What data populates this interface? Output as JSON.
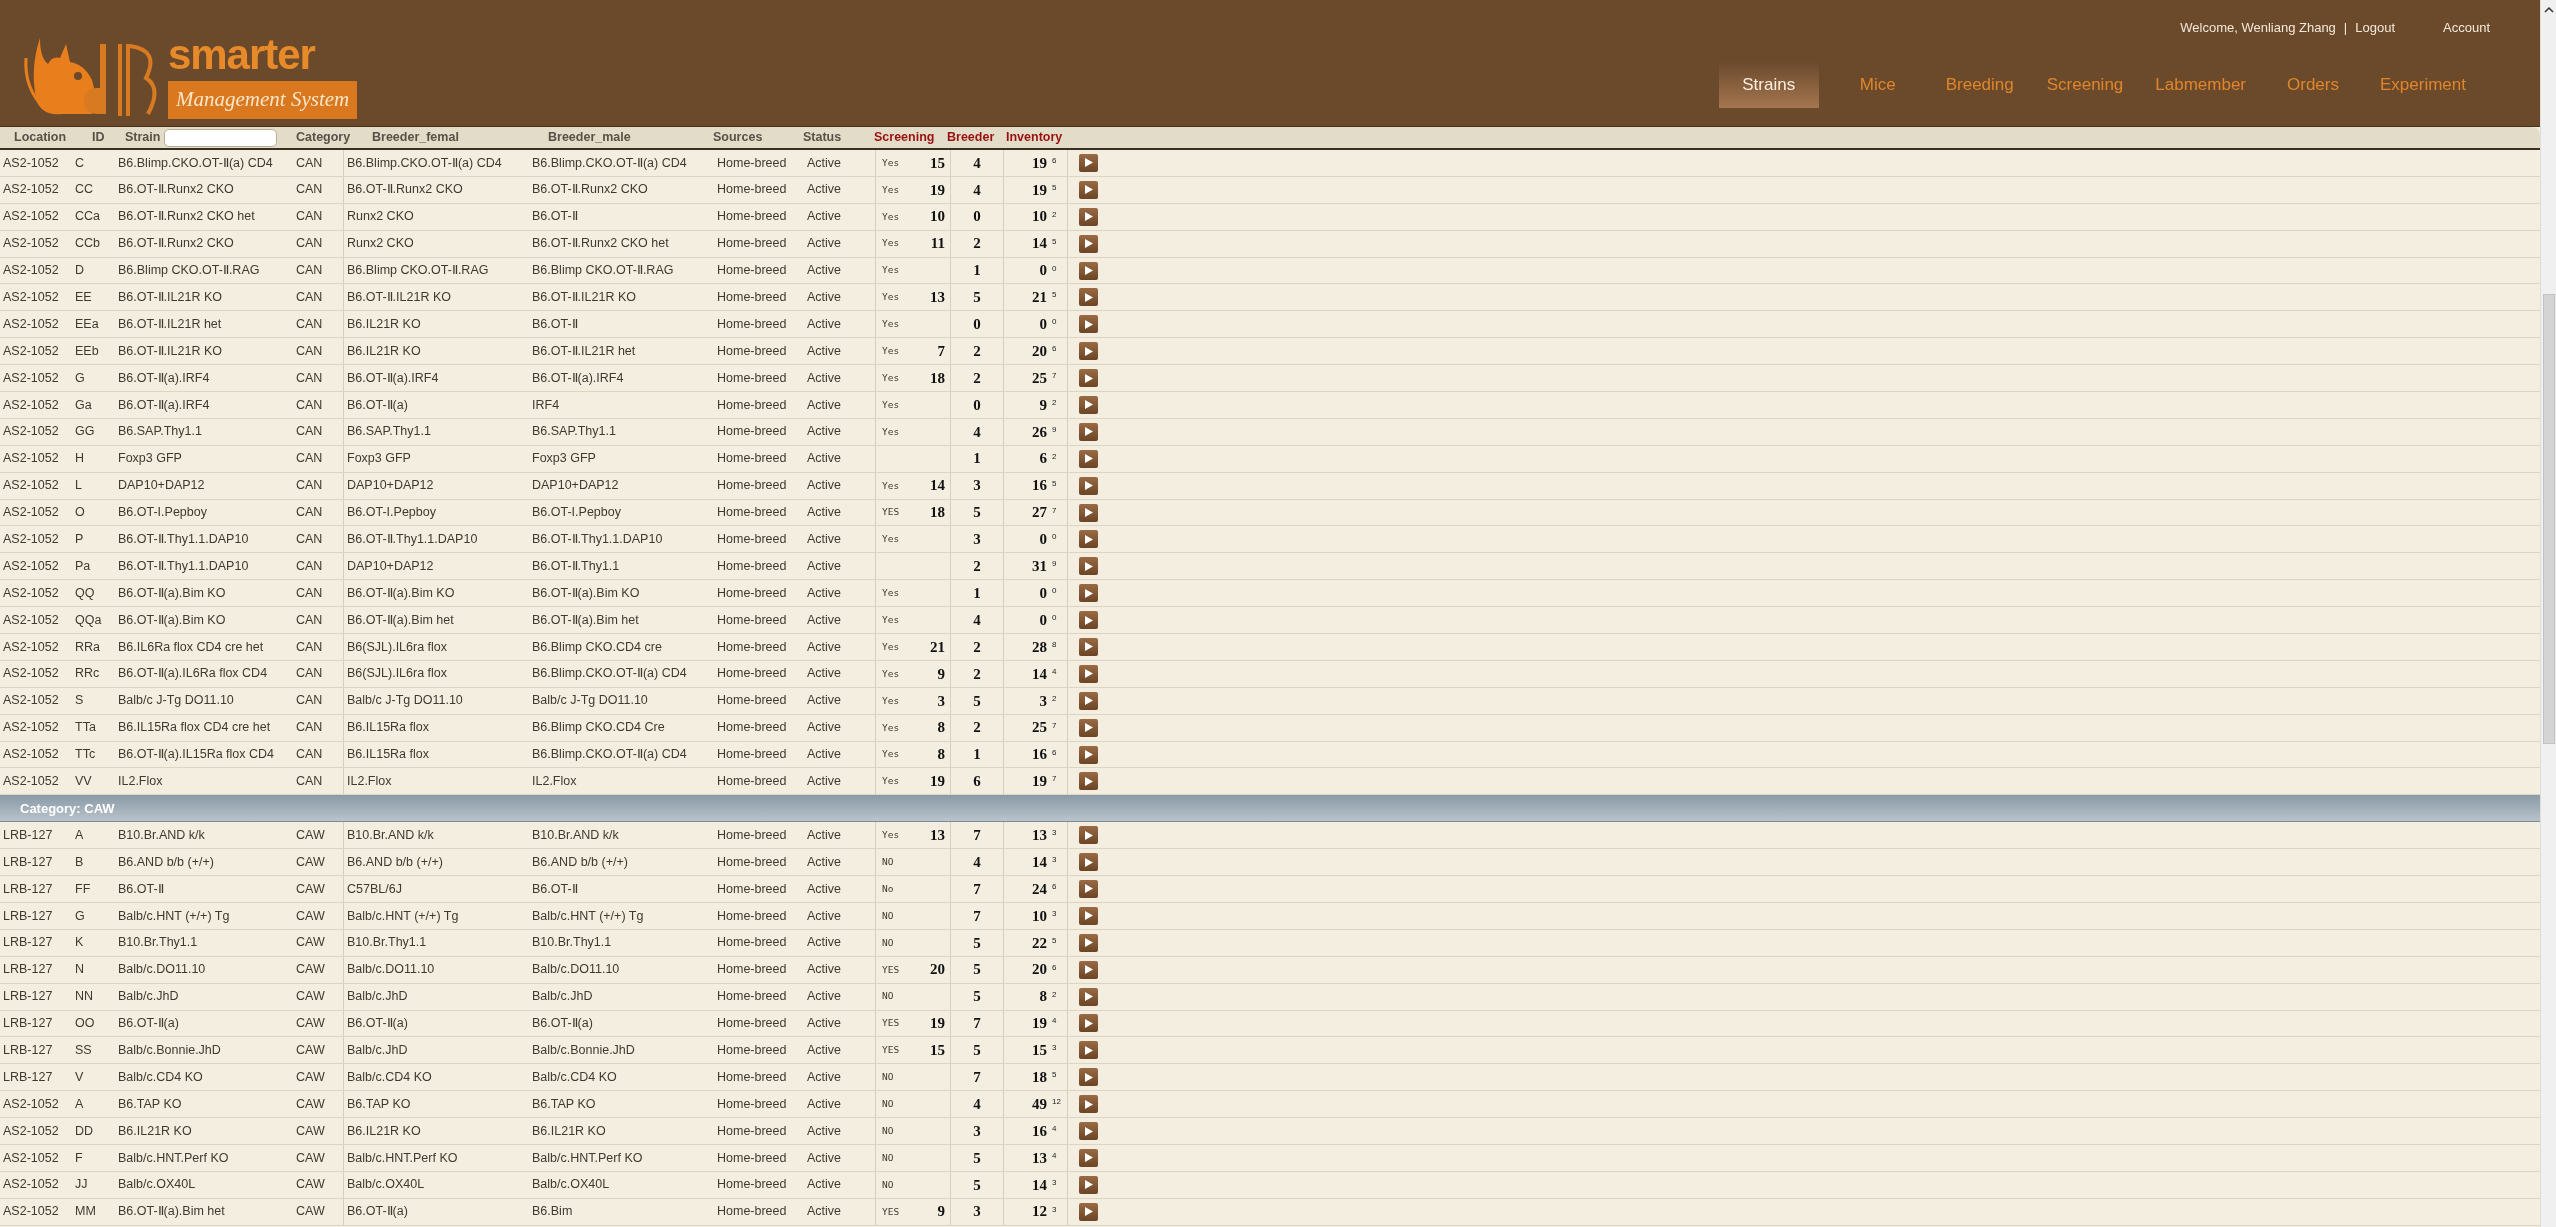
{
  "logo": {
    "word": "smarter",
    "tagline": "Management System"
  },
  "user_bar": {
    "welcome": "Welcome, Wenliang Zhang",
    "separator": "|",
    "logout": "Logout",
    "account": "Account"
  },
  "tabs": [
    {
      "label": "Strains",
      "selected": true
    },
    {
      "label": "Mice",
      "selected": false
    },
    {
      "label": "Breeding",
      "selected": false
    },
    {
      "label": "Screening",
      "selected": false
    },
    {
      "label": "Labmember",
      "selected": false
    },
    {
      "label": "Orders",
      "selected": false
    },
    {
      "label": "Experiment",
      "selected": false
    }
  ],
  "table": {
    "columns": [
      {
        "label": "Location",
        "kind": "plain"
      },
      {
        "label": "ID",
        "kind": "plain"
      },
      {
        "label": "Strain",
        "kind": "filter"
      },
      {
        "label": "Category",
        "kind": "plain"
      },
      {
        "label": "Breeder_femal",
        "kind": "plain"
      },
      {
        "label": "Breeder_male",
        "kind": "plain"
      },
      {
        "label": "Sources",
        "kind": "plain"
      },
      {
        "label": "Status",
        "kind": "plain"
      },
      {
        "label": "Screening",
        "kind": "count"
      },
      {
        "label": "Breeder",
        "kind": "count"
      },
      {
        "label": "Inventory",
        "kind": "count"
      }
    ],
    "groups": [
      {
        "rows": [
          {
            "location": "AS2-1052",
            "id": "C",
            "strain": "B6.Blimp.CKO.OT-Ⅱ(a) CD4",
            "category": "CAN",
            "breeder_female": "B6.Blimp.CKO.OT-Ⅱ(a) CD4",
            "breeder_male": "B6.Blimp.CKO.OT-Ⅱ(a) CD4",
            "source": "Home-breed",
            "status": "Active",
            "screening": "Yes",
            "screening_count": "15",
            "breeder": "4",
            "inventory": "19",
            "inventory_note": "6"
          },
          {
            "location": "AS2-1052",
            "id": "CC",
            "strain": "B6.OT-Ⅱ.Runx2 CKO",
            "category": "CAN",
            "breeder_female": "B6.OT-Ⅱ.Runx2 CKO",
            "breeder_male": "B6.OT-Ⅱ.Runx2 CKO",
            "source": "Home-breed",
            "status": "Active",
            "screening": "Yes",
            "screening_count": "19",
            "breeder": "4",
            "inventory": "19",
            "inventory_note": "5"
          },
          {
            "location": "AS2-1052",
            "id": "CCa",
            "strain": "B6.OT-Ⅱ.Runx2 CKO het",
            "category": "CAN",
            "breeder_female": "Runx2 CKO",
            "breeder_male": "B6.OT-Ⅱ",
            "source": "Home-breed",
            "status": "Active",
            "screening": "Yes",
            "screening_count": "10",
            "breeder": "0",
            "inventory": "10",
            "inventory_note": "2"
          },
          {
            "location": "AS2-1052",
            "id": "CCb",
            "strain": "B6.OT-Ⅱ.Runx2 CKO",
            "category": "CAN",
            "breeder_female": "Runx2 CKO",
            "breeder_male": "B6.OT-Ⅱ.Runx2 CKO het",
            "source": "Home-breed",
            "status": "Active",
            "screening": "Yes",
            "screening_count": "11",
            "breeder": "2",
            "inventory": "14",
            "inventory_note": "5"
          },
          {
            "location": "AS2-1052",
            "id": "D",
            "strain": "B6.Blimp CKO.OT-Ⅱ.RAG",
            "category": "CAN",
            "breeder_female": "B6.Blimp CKO.OT-Ⅱ.RAG",
            "breeder_male": "B6.Blimp CKO.OT-Ⅱ.RAG",
            "source": "Home-breed",
            "status": "Active",
            "screening": "Yes",
            "breeder": "1",
            "inventory": "0",
            "inventory_note": "0"
          },
          {
            "location": "AS2-1052",
            "id": "EE",
            "strain": "B6.OT-Ⅱ.IL21R KO",
            "category": "CAN",
            "breeder_female": "B6.OT-Ⅱ.IL21R KO",
            "breeder_male": "B6.OT-Ⅱ.IL21R KO",
            "source": "Home-breed",
            "status": "Active",
            "screening": "Yes",
            "screening_count": "13",
            "breeder": "5",
            "inventory": "21",
            "inventory_note": "5"
          },
          {
            "location": "AS2-1052",
            "id": "EEa",
            "strain": "B6.OT-Ⅱ.IL21R het",
            "category": "CAN",
            "breeder_female": "B6.IL21R KO",
            "breeder_male": "B6.OT-Ⅱ",
            "source": "Home-breed",
            "status": "Active",
            "screening": "Yes",
            "breeder": "0",
            "inventory": "0",
            "inventory_note": "0"
          },
          {
            "location": "AS2-1052",
            "id": "EEb",
            "strain": "B6.OT-Ⅱ.IL21R KO",
            "category": "CAN",
            "breeder_female": "B6.IL21R KO",
            "breeder_male": "B6.OT-Ⅱ.IL21R het",
            "source": "Home-breed",
            "status": "Active",
            "screening": "Yes",
            "screening_count": "7",
            "breeder": "2",
            "inventory": "20",
            "inventory_note": "6"
          },
          {
            "location": "AS2-1052",
            "id": "G",
            "strain": "B6.OT-Ⅱ(a).IRF4",
            "category": "CAN",
            "breeder_female": "B6.OT-Ⅱ(a).IRF4",
            "breeder_male": "B6.OT-Ⅱ(a).IRF4",
            "source": "Home-breed",
            "status": "Active",
            "screening": "Yes",
            "screening_count": "18",
            "breeder": "2",
            "inventory": "25",
            "inventory_note": "7"
          },
          {
            "location": "AS2-1052",
            "id": "Ga",
            "strain": "B6.OT-Ⅱ(a).IRF4",
            "category": "CAN",
            "breeder_female": "B6.OT-Ⅱ(a)",
            "breeder_male": "IRF4",
            "source": "Home-breed",
            "status": "Active",
            "screening": "Yes",
            "breeder": "0",
            "inventory": "9",
            "inventory_note": "2"
          },
          {
            "location": "AS2-1052",
            "id": "GG",
            "strain": "B6.SAP.Thy1.1",
            "category": "CAN",
            "breeder_female": "B6.SAP.Thy1.1",
            "breeder_male": "B6.SAP.Thy1.1",
            "source": "Home-breed",
            "status": "Active",
            "screening": "Yes",
            "breeder": "4",
            "inventory": "26",
            "inventory_note": "9"
          },
          {
            "location": "AS2-1052",
            "id": "H",
            "strain": "Foxp3 GFP",
            "category": "CAN",
            "breeder_female": "Foxp3 GFP",
            "breeder_male": "Foxp3 GFP",
            "source": "Home-breed",
            "status": "Active",
            "breeder": "1",
            "inventory": "6",
            "inventory_note": "2"
          },
          {
            "location": "AS2-1052",
            "id": "L",
            "strain": "DAP10+DAP12",
            "category": "CAN",
            "breeder_female": "DAP10+DAP12",
            "breeder_male": "DAP10+DAP12",
            "source": "Home-breed",
            "status": "Active",
            "screening": "Yes",
            "screening_count": "14",
            "breeder": "3",
            "inventory": "16",
            "inventory_note": "5"
          },
          {
            "location": "AS2-1052",
            "id": "O",
            "strain": "B6.OT-I.Pepboy",
            "category": "CAN",
            "breeder_female": "B6.OT-I.Pepboy",
            "breeder_male": "B6.OT-I.Pepboy",
            "source": "Home-breed",
            "status": "Active",
            "screening": "YES",
            "screening_count": "18",
            "breeder": "5",
            "inventory": "27",
            "inventory_note": "7"
          },
          {
            "location": "AS2-1052",
            "id": "P",
            "strain": "B6.OT-Ⅱ.Thy1.1.DAP10",
            "category": "CAN",
            "breeder_female": "B6.OT-Ⅱ.Thy1.1.DAP10",
            "breeder_male": "B6.OT-Ⅱ.Thy1.1.DAP10",
            "source": "Home-breed",
            "status": "Active",
            "screening": "Yes",
            "breeder": "3",
            "inventory": "0",
            "inventory_note": "0"
          },
          {
            "location": "AS2-1052",
            "id": "Pa",
            "strain": "B6.OT-Ⅱ.Thy1.1.DAP10",
            "category": "CAN",
            "breeder_female": "DAP10+DAP12",
            "breeder_male": "B6.OT-Ⅱ.Thy1.1",
            "source": "Home-breed",
            "status": "Active",
            "breeder": "2",
            "inventory": "31",
            "inventory_note": "9"
          },
          {
            "location": "AS2-1052",
            "id": "QQ",
            "strain": "B6.OT-Ⅱ(a).Bim KO",
            "category": "CAN",
            "breeder_female": "B6.OT-Ⅱ(a).Bim KO",
            "breeder_male": "B6.OT-Ⅱ(a).Bim KO",
            "source": "Home-breed",
            "status": "Active",
            "screening": "Yes",
            "breeder": "1",
            "inventory": "0",
            "inventory_note": "0"
          },
          {
            "location": "AS2-1052",
            "id": "QQa",
            "strain": "B6.OT-Ⅱ(a).Bim KO",
            "category": "CAN",
            "breeder_female": "B6.OT-Ⅱ(a).Bim het",
            "breeder_male": "B6.OT-Ⅱ(a).Bim het",
            "source": "Home-breed",
            "status": "Active",
            "screening": "Yes",
            "breeder": "4",
            "inventory": "0",
            "inventory_note": "0"
          },
          {
            "location": "AS2-1052",
            "id": "RRa",
            "strain": "B6.IL6Ra flox CD4 cre het",
            "category": "CAN",
            "breeder_female": "B6(SJL).IL6ra flox",
            "breeder_male": "B6.Blimp CKO.CD4 cre",
            "source": "Home-breed",
            "status": "Active",
            "screening": "Yes",
            "screening_count": "21",
            "breeder": "2",
            "inventory": "28",
            "inventory_note": "8"
          },
          {
            "location": "AS2-1052",
            "id": "RRc",
            "strain": "B6.OT-Ⅱ(a).IL6Ra flox CD4",
            "category": "CAN",
            "breeder_female": "B6(SJL).IL6ra flox",
            "breeder_male": "B6.Blimp.CKO.OT-Ⅱ(a) CD4",
            "source": "Home-breed",
            "status": "Active",
            "screening": "Yes",
            "screening_count": "9",
            "breeder": "2",
            "inventory": "14",
            "inventory_note": "4"
          },
          {
            "location": "AS2-1052",
            "id": "S",
            "strain": "Balb/c J-Tg DO11.10",
            "category": "CAN",
            "breeder_female": "Balb/c J-Tg DO11.10",
            "breeder_male": "Balb/c J-Tg DO11.10",
            "source": "Home-breed",
            "status": "Active",
            "screening": "Yes",
            "screening_count": "3",
            "breeder": "5",
            "inventory": "3",
            "inventory_note": "2"
          },
          {
            "location": "AS2-1052",
            "id": "TTa",
            "strain": "B6.IL15Ra flox CD4 cre het",
            "category": "CAN",
            "breeder_female": "B6.IL15Ra flox",
            "breeder_male": "B6.Blimp CKO.CD4 Cre",
            "source": "Home-breed",
            "status": "Active",
            "screening": "Yes",
            "screening_count": "8",
            "breeder": "2",
            "inventory": "25",
            "inventory_note": "7"
          },
          {
            "location": "AS2-1052",
            "id": "TTc",
            "strain": "B6.OT-Ⅱ(a).IL15Ra flox CD4",
            "category": "CAN",
            "breeder_female": "B6.IL15Ra flox",
            "breeder_male": "B6.Blimp.CKO.OT-Ⅱ(a) CD4",
            "source": "Home-breed",
            "status": "Active",
            "screening": "Yes",
            "screening_count": "8",
            "breeder": "1",
            "inventory": "16",
            "inventory_note": "6"
          },
          {
            "location": "AS2-1052",
            "id": "VV",
            "strain": "IL2.Flox",
            "category": "CAN",
            "breeder_female": "IL2.Flox",
            "breeder_male": "IL2.Flox",
            "source": "Home-breed",
            "status": "Active",
            "screening": "Yes",
            "screening_count": "19",
            "breeder": "6",
            "inventory": "19",
            "inventory_note": "7"
          }
        ]
      },
      {
        "title": "Category: CAW",
        "rows": [
          {
            "location": "LRB-127",
            "id": "A",
            "strain": "B10.Br.AND k/k",
            "category": "CAW",
            "breeder_female": "B10.Br.AND k/k",
            "breeder_male": "B10.Br.AND k/k",
            "source": "Home-breed",
            "status": "Active",
            "screening": "Yes",
            "screening_count": "13",
            "breeder": "7",
            "inventory": "13",
            "inventory_note": "3"
          },
          {
            "location": "LRB-127",
            "id": "B",
            "strain": "B6.AND b/b (+/+)",
            "category": "CAW",
            "breeder_female": "B6.AND b/b (+/+)",
            "breeder_male": "B6.AND b/b (+/+)",
            "source": "Home-breed",
            "status": "Active",
            "screening": "NO",
            "breeder": "4",
            "inventory": "14",
            "inventory_note": "3"
          },
          {
            "location": "LRB-127",
            "id": "FF",
            "strain": "B6.OT-Ⅱ",
            "category": "CAW",
            "breeder_female": "C57BL/6J",
            "breeder_male": "B6.OT-Ⅱ",
            "source": "Home-breed",
            "status": "Active",
            "screening": "No",
            "breeder": "7",
            "inventory": "24",
            "inventory_note": "6"
          },
          {
            "location": "LRB-127",
            "id": "G",
            "strain": "Balb/c.HNT (+/+) Tg",
            "category": "CAW",
            "breeder_female": "Balb/c.HNT (+/+) Tg",
            "breeder_male": "Balb/c.HNT (+/+) Tg",
            "source": "Home-breed",
            "status": "Active",
            "screening": "NO",
            "breeder": "7",
            "inventory": "10",
            "inventory_note": "3"
          },
          {
            "location": "LRB-127",
            "id": "K",
            "strain": "B10.Br.Thy1.1",
            "category": "CAW",
            "breeder_female": "B10.Br.Thy1.1",
            "breeder_male": "B10.Br.Thy1.1",
            "source": "Home-breed",
            "status": "Active",
            "screening": "NO",
            "breeder": "5",
            "inventory": "22",
            "inventory_note": "5"
          },
          {
            "location": "LRB-127",
            "id": "N",
            "strain": "Balb/c.DO11.10",
            "category": "CAW",
            "breeder_female": "Balb/c.DO11.10",
            "breeder_male": "Balb/c.DO11.10",
            "source": "Home-breed",
            "status": "Active",
            "screening": "YES",
            "screening_count": "20",
            "breeder": "5",
            "inventory": "20",
            "inventory_note": "6"
          },
          {
            "location": "LRB-127",
            "id": "NN",
            "strain": "Balb/c.JhD",
            "category": "CAW",
            "breeder_female": "Balb/c.JhD",
            "breeder_male": "Balb/c.JhD",
            "source": "Home-breed",
            "status": "Active",
            "screening": "NO",
            "breeder": "5",
            "inventory": "8",
            "inventory_note": "2"
          },
          {
            "location": "LRB-127",
            "id": "OO",
            "strain": "B6.OT-Ⅱ(a)",
            "category": "CAW",
            "breeder_female": "B6.OT-Ⅱ(a)",
            "breeder_male": "B6.OT-Ⅱ(a)",
            "source": "Home-breed",
            "status": "Active",
            "screening": "YES",
            "screening_count": "19",
            "breeder": "7",
            "inventory": "19",
            "inventory_note": "4"
          },
          {
            "location": "LRB-127",
            "id": "SS",
            "strain": "Balb/c.Bonnie.JhD",
            "category": "CAW",
            "breeder_female": "Balb/c.JhD",
            "breeder_male": "Balb/c.Bonnie.JhD",
            "source": "Home-breed",
            "status": "Active",
            "screening": "YES",
            "screening_count": "15",
            "breeder": "5",
            "inventory": "15",
            "inventory_note": "3"
          },
          {
            "location": "LRB-127",
            "id": "V",
            "strain": "Balb/c.CD4 KO",
            "category": "CAW",
            "breeder_female": "Balb/c.CD4 KO",
            "breeder_male": "Balb/c.CD4 KO",
            "source": "Home-breed",
            "status": "Active",
            "screening": "NO",
            "breeder": "7",
            "inventory": "18",
            "inventory_note": "5"
          },
          {
            "location": "AS2-1052",
            "id": "A",
            "strain": "B6.TAP KO",
            "category": "CAW",
            "breeder_female": "B6.TAP KO",
            "breeder_male": "B6.TAP KO",
            "source": "Home-breed",
            "status": "Active",
            "screening": "NO",
            "breeder": "4",
            "inventory": "49",
            "inventory_note": "12"
          },
          {
            "location": "AS2-1052",
            "id": "DD",
            "strain": "B6.IL21R KO",
            "category": "CAW",
            "breeder_female": "B6.IL21R KO",
            "breeder_male": "B6.IL21R KO",
            "source": "Home-breed",
            "status": "Active",
            "screening": "NO",
            "breeder": "3",
            "inventory": "16",
            "inventory_note": "4"
          },
          {
            "location": "AS2-1052",
            "id": "F",
            "strain": "Balb/c.HNT.Perf KO",
            "category": "CAW",
            "breeder_female": "Balb/c.HNT.Perf KO",
            "breeder_male": "Balb/c.HNT.Perf KO",
            "source": "Home-breed",
            "status": "Active",
            "screening": "NO",
            "breeder": "5",
            "inventory": "13",
            "inventory_note": "4"
          },
          {
            "location": "AS2-1052",
            "id": "JJ",
            "strain": "Balb/c.OX40L",
            "category": "CAW",
            "breeder_female": "Balb/c.OX40L",
            "breeder_male": "Balb/c.OX40L",
            "source": "Home-breed",
            "status": "Active",
            "screening": "NO",
            "breeder": "5",
            "inventory": "14",
            "inventory_note": "3"
          },
          {
            "location": "AS2-1052",
            "id": "MM",
            "strain": "B6.OT-Ⅱ(a).Bim het",
            "category": "CAW",
            "breeder_female": "B6.OT-Ⅱ(a)",
            "breeder_male": "B6.Bim",
            "source": "Home-breed",
            "status": "Active",
            "screening": "YES",
            "screening_count": "9",
            "breeder": "3",
            "inventory": "12",
            "inventory_note": "3"
          }
        ]
      }
    ]
  }
}
